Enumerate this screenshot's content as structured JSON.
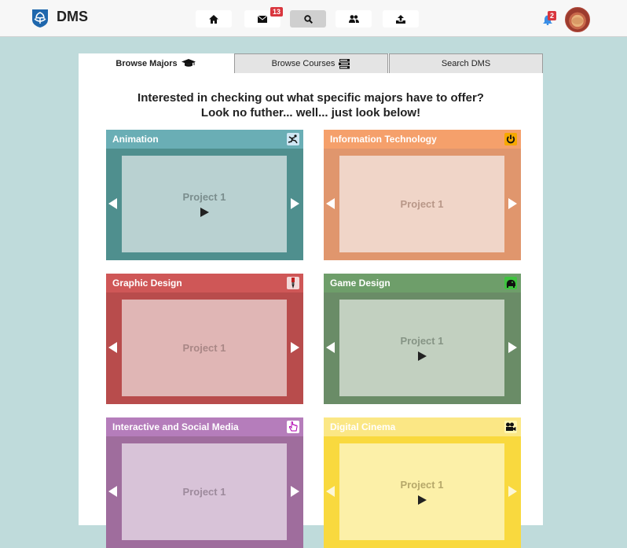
{
  "app": {
    "brand": "DMS"
  },
  "nav": {
    "items": [
      {
        "name": "home",
        "icon": "home-icon"
      },
      {
        "name": "mail",
        "icon": "mail-icon",
        "badge": "13"
      },
      {
        "name": "search",
        "icon": "search-icon",
        "active": true
      },
      {
        "name": "users",
        "icon": "users-icon"
      },
      {
        "name": "upload",
        "icon": "upload-icon"
      }
    ],
    "notifications_badge": "2"
  },
  "tabs": [
    {
      "label": "Browse Majors",
      "icon": "graduation-cap-icon",
      "active": true
    },
    {
      "label": "Browse Courses",
      "icon": "books-icon",
      "active": false
    },
    {
      "label": "Search DMS",
      "active": false
    }
  ],
  "heading": {
    "line1": "Interested in checking out what specific majors have to offer?",
    "line2": "Look no futher... well... just look below!"
  },
  "majors": [
    {
      "name": "Animation",
      "project": "Project 1",
      "has_play": true,
      "color": "#6aaeb5",
      "icon": "running-figure-icon"
    },
    {
      "name": "Information Technology",
      "project": "Project 1",
      "has_play": false,
      "color": "#f5a06b",
      "icon": "power-icon"
    },
    {
      "name": "Graphic Design",
      "project": "Project 1",
      "has_play": false,
      "color": "#cf5757",
      "icon": "paintbrush-icon"
    },
    {
      "name": "Game Design",
      "project": "Project 1",
      "has_play": true,
      "color": "#6e9e6a",
      "icon": "game-character-icon"
    },
    {
      "name": "Interactive and Social Media",
      "project": "Project 1",
      "has_play": false,
      "color": "#b57dbb",
      "icon": "hand-pointer-icon"
    },
    {
      "name": "Digital Cinema",
      "project": "Project 1",
      "has_play": true,
      "color": "#fbe785",
      "icon": "film-camera-icon"
    }
  ]
}
